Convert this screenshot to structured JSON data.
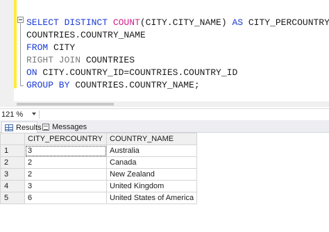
{
  "editor": {
    "lines": [
      [
        {
          "t": "SELECT DISTINCT ",
          "c": "kw"
        },
        {
          "t": "COUNT",
          "c": "fn"
        },
        {
          "t": "(CITY.CITY_NAME) ",
          "c": ""
        },
        {
          "t": "AS",
          "c": "kw"
        },
        {
          "t": " CITY_PERCOUNTRY,",
          "c": ""
        }
      ],
      [
        {
          "t": "COUNTRIES.COUNTRY_NAME",
          "c": ""
        }
      ],
      [
        {
          "t": "FROM",
          "c": "kw"
        },
        {
          "t": " CITY",
          "c": ""
        }
      ],
      [
        {
          "t": "RIGHT JOIN",
          "c": "gr"
        },
        {
          "t": " COUNTRIES",
          "c": ""
        }
      ],
      [
        {
          "t": "ON",
          "c": "kw"
        },
        {
          "t": " CITY.COUNTRY_ID=COUNTRIES.COUNTRY_ID",
          "c": ""
        }
      ],
      [
        {
          "t": "GROUP BY",
          "c": "kw"
        },
        {
          "t": " COUNTRIES.COUNTRY_NAME;",
          "c": ""
        }
      ]
    ]
  },
  "zoom": {
    "value": "121 %"
  },
  "tabs": {
    "results": "Results",
    "messages": "Messages"
  },
  "grid": {
    "columns": [
      "CITY_PERCOUNTRY",
      "COUNTRY_NAME"
    ],
    "rows": [
      {
        "num": "1",
        "city_percountry": "3",
        "country_name": "Australia"
      },
      {
        "num": "2",
        "city_percountry": "2",
        "country_name": "Canada"
      },
      {
        "num": "3",
        "city_percountry": "2",
        "country_name": "New Zealand"
      },
      {
        "num": "4",
        "city_percountry": "3",
        "country_name": "United Kingdom"
      },
      {
        "num": "5",
        "city_percountry": "6",
        "country_name": "United States of America"
      }
    ]
  }
}
